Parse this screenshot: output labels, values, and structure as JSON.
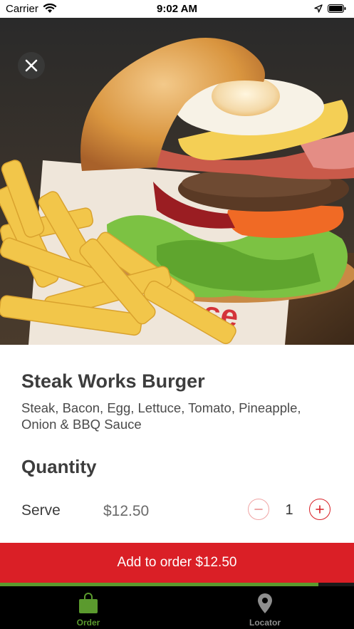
{
  "status_bar": {
    "carrier": "Carrier",
    "time": "9:02 AM",
    "icons": [
      "wifi-icon",
      "location-arrow-icon",
      "battery-icon"
    ]
  },
  "product": {
    "image_alt": "Steak Works Burger with fries",
    "close_icon": "close-icon",
    "name": "Steak Works Burger",
    "description": "Steak, Bacon, Egg, Lettuce, Tomato, Pineapple, Onion & BBQ Sauce"
  },
  "quantity": {
    "heading": "Quantity",
    "serve_label": "Serve",
    "serve_price": "$12.50",
    "count": "1",
    "minus_icon": "minus-icon",
    "plus_icon": "plus-icon"
  },
  "order": {
    "add_label": "Add to order $12.50",
    "progress": 0.9
  },
  "tab_bar": {
    "tabs": [
      {
        "label": "Order",
        "icon": "shopping-bag-icon",
        "active": true
      },
      {
        "label": "Locator",
        "icon": "map-pin-icon",
        "active": false
      }
    ]
  },
  "colors": {
    "accent_red": "#da1f26",
    "active_green": "#5b9a2e",
    "inactive_gray": "#8e8e8e",
    "tab_bar_bg": "#000000"
  }
}
